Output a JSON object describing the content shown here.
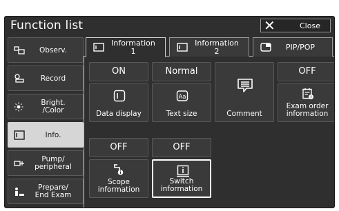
{
  "window": {
    "title": "Function list",
    "close_label": "Close"
  },
  "sidebar": {
    "items": [
      {
        "label": "Observ.",
        "icon": "observation-icon",
        "active": false
      },
      {
        "label": "Record",
        "icon": "record-icon",
        "active": false
      },
      {
        "label_1": "Bright.",
        "label_2": "/Color",
        "icon": "brightness-icon",
        "active": false
      },
      {
        "label": "Info.",
        "icon": "info-icon",
        "active": true
      },
      {
        "label_1": "Pump/",
        "label_2": "peripheral",
        "icon": "pump-icon",
        "active": false
      },
      {
        "label_1": "Prepare/",
        "label_2": "End Exam",
        "icon": "prepare-icon",
        "active": false
      }
    ]
  },
  "tabs": [
    {
      "line_1": "Information",
      "line_2": "1",
      "active": true
    },
    {
      "line_1": "Information",
      "line_2": "2",
      "active": false
    },
    {
      "label": "PIP/POP",
      "active": false
    }
  ],
  "tiles": [
    {
      "status": "ON",
      "caption": "Data display",
      "icon": "data-display-icon"
    },
    {
      "status": "Normal",
      "caption": "Text size",
      "icon": "text-size-icon"
    },
    {
      "status": "",
      "caption": "Comment",
      "icon": "comment-icon"
    },
    {
      "status": "OFF",
      "caption_1": "Exam order",
      "caption_2": "information",
      "icon": "exam-order-icon"
    },
    {
      "status": "OFF",
      "caption_1": "Scope",
      "caption_2": "information",
      "icon": "scope-info-icon"
    },
    {
      "status": "OFF",
      "caption_1": "Switch",
      "caption_2": "information",
      "icon": "switch-info-icon",
      "selected": true
    }
  ],
  "colors": {
    "panel": "#2f2f2f",
    "button": "#3a3a3a",
    "active_sidebar": "#d6d6d6",
    "text": "#ffffff"
  }
}
